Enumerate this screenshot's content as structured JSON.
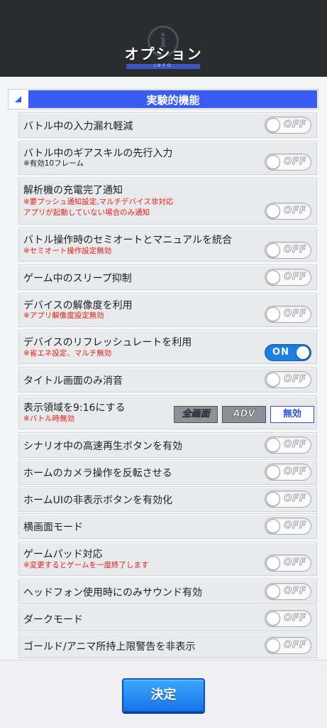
{
  "header": {
    "title": "オプション",
    "subtitle": "INFO",
    "emblem_glyph": "i"
  },
  "section": {
    "title": "実験的機能"
  },
  "settings": [
    {
      "title": "バトル中の入力漏れ軽減",
      "toggle": "OFF"
    },
    {
      "title": "バトル中のギアスキルの先行入力",
      "note": "※有効10フレーム",
      "toggle": "OFF"
    },
    {
      "title": "解析機の充電完了通知",
      "note1": "※要プッシュ通知設定,マルチデバイス非対応",
      "note2": "アプリが起動していない場合のみ通知",
      "toggle": "OFF"
    },
    {
      "title": "バトル操作時のセミオートとマニュアルを統合",
      "note": "※セミオート操作設定無効",
      "toggle": "OFF"
    },
    {
      "title": "ゲーム中のスリープ抑制",
      "toggle": "OFF"
    },
    {
      "title": "デバイスの解像度を利用",
      "note": "※アプリ解像度設定無効",
      "toggle": "OFF"
    },
    {
      "title": "デバイスのリフレッシュレートを利用",
      "note": "※省エネ設定、マルチ無効",
      "toggle": "ON"
    },
    {
      "title": "タイトル画面のみ消音",
      "toggle": "OFF"
    },
    {
      "title": "表示領域を9:16にする",
      "note": "※バトル時無効",
      "options": [
        "全画面",
        "ADV",
        "無効"
      ],
      "selected": "無効"
    },
    {
      "title": "シナリオ中の高速再生ボタンを有効",
      "toggle": "OFF"
    },
    {
      "title": "ホームのカメラ操作を反転させる",
      "toggle": "OFF"
    },
    {
      "title": "ホームUIの非表示ボタンを有効化",
      "toggle": "OFF"
    },
    {
      "title": "横画面モード",
      "toggle": "OFF"
    },
    {
      "title": "ゲームパッド対応",
      "note": "※変更するとゲームを一度終了します",
      "toggle": "OFF"
    },
    {
      "title": "ヘッドフォン使用時にのみサウンド有効",
      "toggle": "OFF"
    },
    {
      "title": "ダークモード",
      "toggle": "OFF"
    },
    {
      "title": "ゴールド/アニマ所持上限警告を非表示",
      "toggle": "OFF"
    }
  ],
  "footer": {
    "confirm_label": "決定"
  },
  "colors": {
    "accent": "#3a5bf0",
    "toggle_on": "#1d7fe0",
    "note_red": "#e0201b"
  }
}
